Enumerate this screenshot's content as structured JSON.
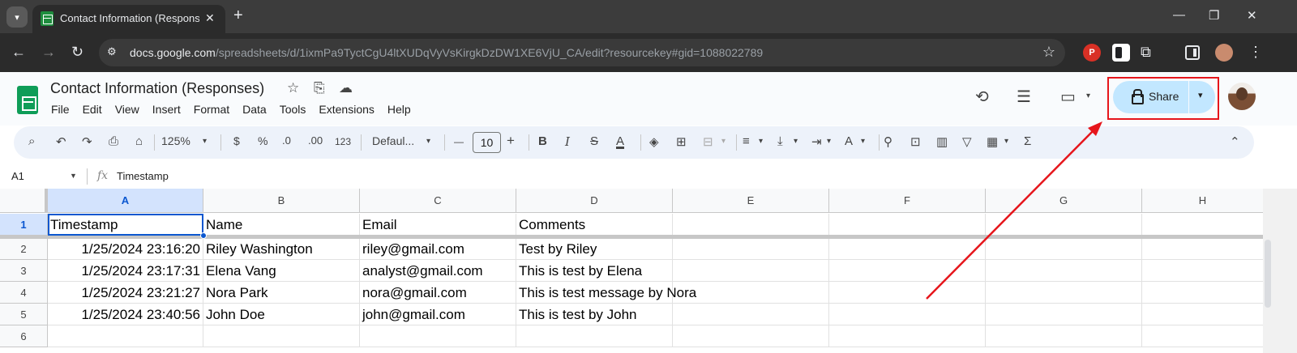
{
  "browser": {
    "tab_title": "Contact Information (Responses)",
    "url_host": "docs.google.com",
    "url_path": "/spreadsheets/d/1ixmPa9TyctCgU4ltXUDqVyVsKirgkDzDW1XE6VjU_CA/edit?resourcekey#gid=1088022789",
    "tab_close": "✕",
    "new_tab": "+",
    "window_minimize": "—",
    "window_restore": "❐",
    "window_close": "✕",
    "back": "←",
    "forward": "→",
    "reload": "↻",
    "site_info": "⚙",
    "star": "☆",
    "ext_puzzle": "⧉",
    "menu": "⋮"
  },
  "sheet": {
    "title": "Contact Information (Responses)",
    "menus": [
      "File",
      "Edit",
      "View",
      "Insert",
      "Format",
      "Data",
      "Tools",
      "Extensions",
      "Help"
    ],
    "share_label": "Share",
    "caret": "▾"
  },
  "toolbar": {
    "zoom": "125%",
    "currency": "$",
    "percent": "%",
    "dec_decrease": ".0",
    "dec_increase": ".00",
    "number_format": "123",
    "font": "Defaul...",
    "font_size": "10",
    "minus": "—",
    "plus": "+",
    "bold": "B",
    "italic": "I",
    "strike": "S",
    "text_color": "A",
    "function": "Σ",
    "collapse": "⌃"
  },
  "formula_bar": {
    "name_box": "A1",
    "fx": "fx",
    "value": "Timestamp"
  },
  "grid": {
    "columns": [
      "A",
      "B",
      "C",
      "D",
      "E",
      "F",
      "G",
      "H"
    ],
    "row_numbers": [
      "1",
      "2",
      "3",
      "4",
      "5",
      "6"
    ],
    "header_row": [
      "Timestamp",
      "Name",
      "Email",
      "Comments"
    ],
    "rows": [
      [
        "1/25/2024 23:16:20",
        "Riley Washington",
        "riley@gmail.com",
        "Test by Riley"
      ],
      [
        "1/25/2024 23:17:31",
        "Elena Vang",
        "analyst@gmail.com",
        "This is test by Elena"
      ],
      [
        "1/25/2024 23:21:27",
        "Nora Park",
        "nora@gmail.com",
        "This is test message by Nora"
      ],
      [
        "1/25/2024 23:40:56",
        "John Doe",
        "john@gmail.com",
        "This is test by John"
      ]
    ]
  },
  "colors": {
    "share_bg": "#c2e7ff",
    "highlight": "#e6151b",
    "selection": "#0b57d0"
  }
}
